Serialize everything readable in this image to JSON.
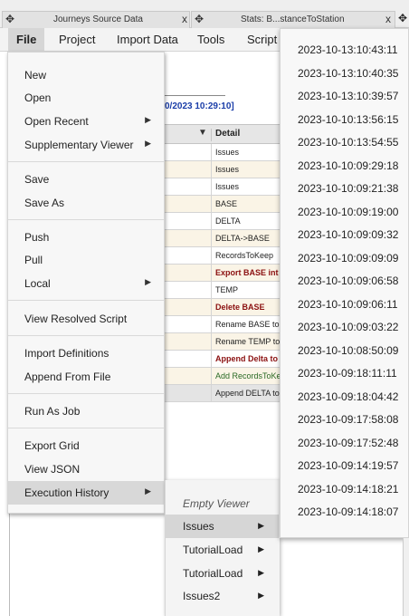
{
  "tabs": [
    {
      "label": "Journeys Source Data"
    },
    {
      "label": "Stats: B...stanceToStation"
    }
  ],
  "menubar": {
    "file": "File",
    "project": "Project",
    "import_data": "Import Data",
    "tools": "Tools",
    "script": "Script"
  },
  "grid": {
    "date_text": "0/2023 10:29:10]",
    "column_header": "Detail",
    "rows": [
      {
        "detail": "Issues",
        "style": "normal",
        "bg": "plain"
      },
      {
        "detail": "Issues",
        "style": "normal",
        "bg": "alt"
      },
      {
        "detail": "Issues",
        "style": "normal",
        "bg": "plain"
      },
      {
        "detail": "BASE",
        "style": "normal",
        "bg": "alt"
      },
      {
        "detail": "DELTA",
        "style": "normal",
        "bg": "plain"
      },
      {
        "detail": "DELTA->BASE",
        "style": "normal",
        "bg": "alt"
      },
      {
        "detail": "RecordsToKeep",
        "style": "normal",
        "bg": "plain"
      },
      {
        "detail": "Export BASE int",
        "style": "red",
        "bg": "alt"
      },
      {
        "detail": "TEMP",
        "style": "normal",
        "bg": "plain"
      },
      {
        "detail": "Delete BASE",
        "style": "red",
        "bg": "alt"
      },
      {
        "detail": "Rename BASE to",
        "style": "normal",
        "bg": "plain"
      },
      {
        "detail": "Rename TEMP to",
        "style": "normal",
        "bg": "alt"
      },
      {
        "detail": "Append Delta to",
        "style": "red",
        "bg": "plain"
      },
      {
        "detail": "Add RecordsToKe",
        "style": "green",
        "bg": "alt"
      },
      {
        "detail": "Append DELTA to",
        "style": "normal",
        "bg": "sel"
      }
    ]
  },
  "file_menu": {
    "new": "New",
    "open": "Open",
    "open_recent": "Open Recent",
    "supplementary_viewer": "Supplementary Viewer",
    "save": "Save",
    "save_as": "Save As",
    "push": "Push",
    "pull": "Pull",
    "local": "Local",
    "view_resolved_script": "View Resolved Script",
    "import_definitions": "Import Definitions",
    "append_from_file": "Append From File",
    "run_as_job": "Run As Job",
    "export_grid": "Export Grid",
    "view_json": "View JSON",
    "execution_history": "Execution History"
  },
  "execution_submenu": {
    "empty_viewer": "Empty Viewer",
    "issues": "Issues",
    "tutorial_load_1": "TutorialLoad",
    "tutorial_load_2": "TutorialLoad",
    "issues2": "Issues2"
  },
  "timestamps": [
    "2023-10-13:10:43:11",
    "2023-10-13:10:40:35",
    "2023-10-13:10:39:57",
    "2023-10-10:13:56:15",
    "2023-10-10:13:54:55",
    "2023-10-10:09:29:18",
    "2023-10-10:09:21:38",
    "2023-10-10:09:19:00",
    "2023-10-10:09:09:32",
    "2023-10-10:09:09:09",
    "2023-10-10:09:06:58",
    "2023-10-10:09:06:11",
    "2023-10-10:09:03:22",
    "2023-10-10:08:50:09",
    "2023-10-09:18:11:11",
    "2023-10-09:18:04:42",
    "2023-10-09:17:58:08",
    "2023-10-09:17:52:48",
    "2023-10-09:14:19:57",
    "2023-10-09:14:18:21",
    "2023-10-09:14:18:07"
  ],
  "icons": {
    "move": "move-icon",
    "close": "close-icon",
    "submenu": "chevron-right-icon",
    "filter": "filter-icon"
  }
}
